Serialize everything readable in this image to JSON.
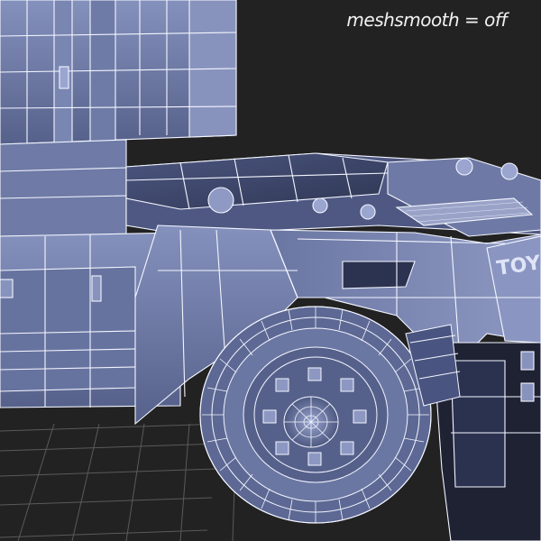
{
  "viewport": {
    "overlay_label": "meshsmooth = off",
    "render_mode": "wireframe-on-shaded",
    "brand_lettering": "TOYOTA",
    "colors": {
      "background": "#222223",
      "mesh_fill_light": "#7c88b3",
      "mesh_fill_mid": "#5c6892",
      "mesh_fill_dark": "#3d4668",
      "wire": "#f4f6ff",
      "ground_grid": "#5a5a5a",
      "tire": "#6a76a3"
    }
  }
}
